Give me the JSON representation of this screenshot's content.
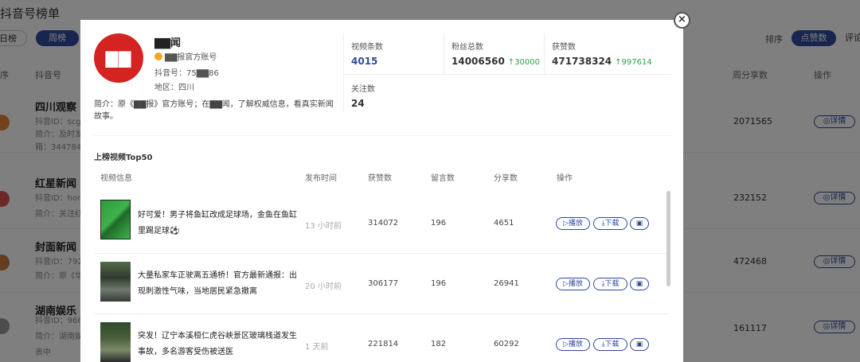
{
  "background": {
    "title": "抖音号榜单",
    "tabs": [
      "日榜",
      "周榜"
    ],
    "sort_label": "排序",
    "sort_options": [
      "点赞数",
      "评论"
    ],
    "col_rank": "序",
    "col_account": "抖音号",
    "col_share": "周分享数",
    "col_ops": "操作",
    "detail_label": "详情",
    "rows": [
      {
        "name": "四川观察",
        "line1": "抖音ID：scg",
        "line2": "简介：及时发",
        "line3": "箱：344784",
        "share": "2071565"
      },
      {
        "name": "红星新闻",
        "line1": "抖音ID：hon",
        "line2": "简介：关注红",
        "line3": "",
        "share": "232152"
      },
      {
        "name": "封面新闻",
        "line1": "抖音ID：792",
        "line2": "简介：原《华",
        "line3": "",
        "share": "472468"
      },
      {
        "name": "湖南娱乐",
        "line1": "抖音ID：966",
        "line2": "简介：湖南娱",
        "line3": "表中",
        "share": "161117"
      }
    ]
  },
  "modal": {
    "avatar_text": "▇▇",
    "account_name": "▇▇闻",
    "verified_text": "▇▇报官方账号",
    "douyin_id": "抖音号：75▇▇86",
    "region": "地区：四川",
    "intro": "简介：原《▇▇报》官方账号；在▇▇闻，了解权威信息，看真实新闻故事。",
    "stats": {
      "videos": {
        "label": "视频条数",
        "value": "4015"
      },
      "fans": {
        "label": "粉丝总数",
        "value": "14006560",
        "increase": "30000"
      },
      "likes": {
        "label": "获赞数",
        "value": "471738324",
        "increase": "997614"
      },
      "following": {
        "label": "关注数",
        "value": "24"
      }
    },
    "section_title": "上榜视频Top50",
    "columns": [
      "视频信息",
      "发布时间",
      "获赞数",
      "留言数",
      "分享数",
      "操作"
    ],
    "buttons": {
      "play": "播放",
      "download": "下载"
    },
    "videos": [
      {
        "title": "好可爱！男子将鱼缸改成足球场，金鱼在鱼缸里踢足球⚽",
        "time": "13 小时前",
        "likes": "314072",
        "comments": "196",
        "shares": "4651"
      },
      {
        "title": "大量私家车正驶离五通桥！官方最新通报：出现刺激性气味，当地居民紧急撤离",
        "time": "20 小时前",
        "likes": "306177",
        "comments": "196",
        "shares": "26941"
      },
      {
        "title": "突发！辽宁本溪桓仁虎谷峡景区玻璃栈道发生事故，多名游客受伤被送医",
        "time": "1 天前",
        "likes": "221814",
        "comments": "182",
        "shares": "60292"
      }
    ]
  },
  "colors": {
    "accent": "#2e4a9e",
    "brand_red": "#d42320",
    "increase_green": "#2aa146"
  }
}
